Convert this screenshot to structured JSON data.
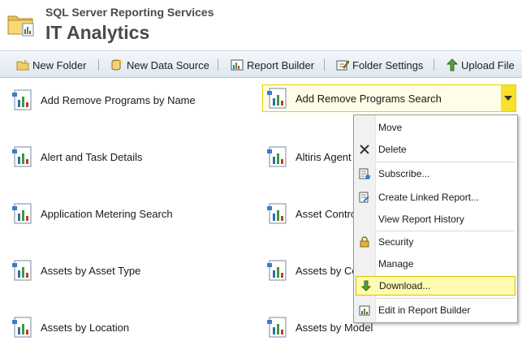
{
  "header": {
    "app_name": "SQL Server Reporting Services",
    "site_title": "IT Analytics"
  },
  "toolbar": {
    "new_folder": "New Folder",
    "new_data_source": "New Data Source",
    "report_builder": "Report Builder",
    "folder_settings": "Folder Settings",
    "upload_file": "Upload File"
  },
  "reports": {
    "left": [
      "Add Remove Programs by Name",
      "Alert and Task Details",
      "Application Metering Search",
      "Assets by Asset Type",
      "Assets by Location"
    ],
    "right": [
      "Add Remove Programs Search",
      "Altiris Agent",
      "Asset Contro",
      "Assets by Co",
      "Assets by Model"
    ]
  },
  "context_menu": {
    "items": [
      "Move",
      "Delete",
      "Subscribe...",
      "Create Linked Report...",
      "View Report History",
      "Security",
      "Manage",
      "Download...",
      "Edit in Report Builder"
    ]
  },
  "colors": {
    "selection_border": "#e6d200",
    "dropdown_arrow_bg": "#f7e12b",
    "menu_highlight": "#fffbb0",
    "toolbar_gradient_top": "#f4f8fc",
    "toolbar_gradient_bottom": "#dde6ef"
  }
}
